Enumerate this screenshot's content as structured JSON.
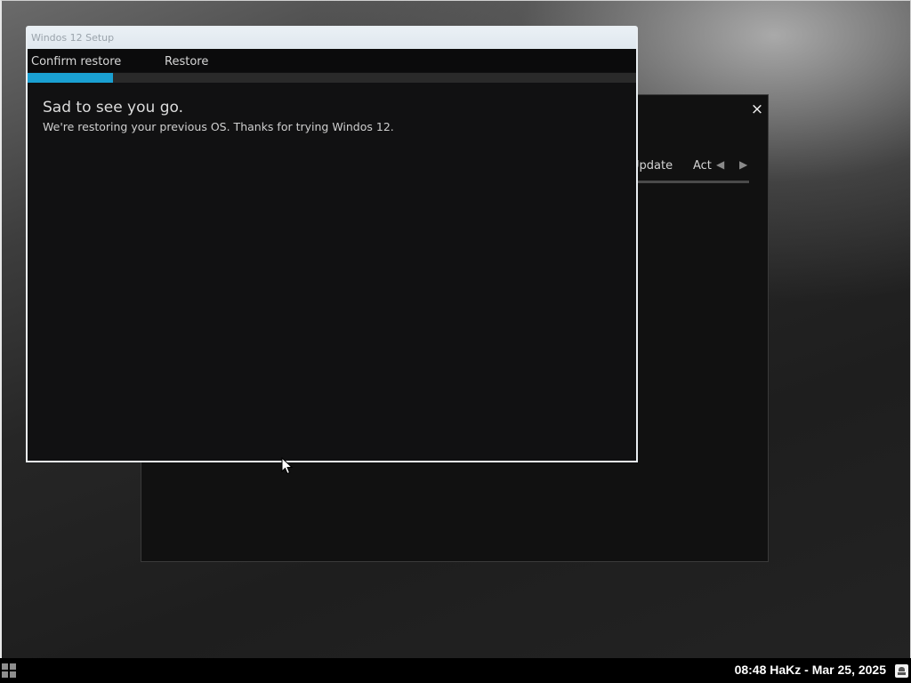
{
  "setup_window": {
    "title": "Windos 12 Setup",
    "steps": [
      "Confirm restore",
      "Restore"
    ],
    "progress_percent": 14,
    "accent_color": "#1aa0d2",
    "heading": "Sad to see you go.",
    "message": "We're restoring your previous OS. Thanks for trying Windos 12."
  },
  "background_window": {
    "close_icon": "×",
    "tabs": [
      "Update",
      "Acti"
    ],
    "nav_left_icon": "◀",
    "nav_right_icon": "▶"
  },
  "taskbar": {
    "start_icon": "grid-icon",
    "clock_text": "08:48 HaKz - Mar 25, 2025",
    "tray_icon": "user-icon"
  }
}
